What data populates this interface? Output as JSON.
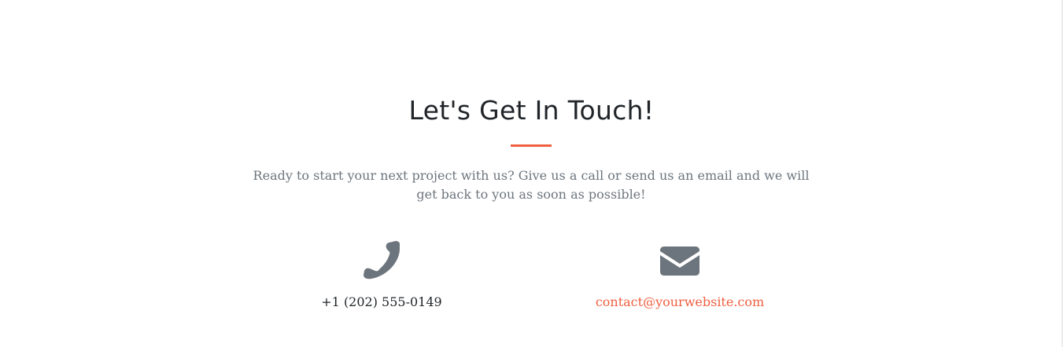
{
  "section": {
    "title": "Let's Get In Touch!",
    "lead": "Ready to start your next project with us? Give us a call or send us an email and we will get back to you as soon as possible!"
  },
  "contacts": {
    "phone": {
      "icon": "phone-icon",
      "number": "+1 (202) 555-0149"
    },
    "email": {
      "icon": "envelope-icon",
      "address": "contact@yourwebsite.com"
    }
  },
  "colors": {
    "accent": "#f05f40",
    "heading": "#212529",
    "muted": "#6c757d",
    "icon": "#6c757d"
  }
}
